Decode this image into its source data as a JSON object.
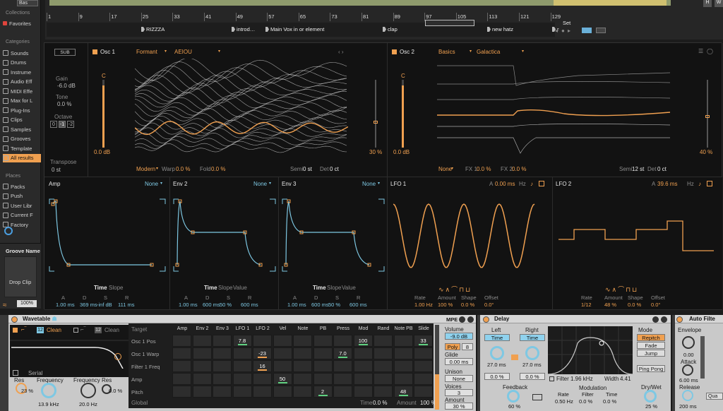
{
  "browser": {
    "top_label": "Bas",
    "collections_header": "Collections",
    "favorites": "Favorites",
    "categories_header": "Categories",
    "categories": [
      "Sounds",
      "Drums",
      "Instrume",
      "Audio Eff",
      "MIDI Effe",
      "Max for L",
      "Plug-Ins",
      "Clips",
      "Samples",
      "Grooves",
      "Template",
      "All results"
    ],
    "places_header": "Places",
    "places": [
      "Packs",
      "Push",
      "User Libr",
      "Current F",
      "Factory"
    ],
    "groove_name": "Groove Name",
    "drop_clip": "Drop Clip",
    "zoom": "100%"
  },
  "arrangement": {
    "markers": [
      "1",
      "9",
      "17",
      "25",
      "33",
      "41",
      "49",
      "57",
      "65",
      "73",
      "81",
      "89",
      "97",
      "105",
      "113",
      "121",
      "129"
    ],
    "locators": [
      "RIZZZA",
      "introd…",
      "Main Vox in or element",
      "clap",
      "new hatz",
      "r"
    ],
    "set_label": "Set",
    "top_buttons": [
      "H",
      "W"
    ]
  },
  "sub": {
    "label": "SUB",
    "gain_label": "Gain",
    "gain_value": "-6.0 dB",
    "tone_label": "Tone",
    "tone_value": "0.0 %",
    "octave_label": "Octave",
    "octave_options": [
      "0",
      "-1",
      "-2"
    ],
    "transpose_label": "Transpose",
    "transpose_value": "0 st"
  },
  "osc1": {
    "label": "Osc 1",
    "category": "Formant",
    "table": "AEIOU",
    "note": "C",
    "gain": "0.0 dB",
    "level": "30 %",
    "mode": "Modern",
    "warp_label": "Warp",
    "warp": "0.0 %",
    "fold_label": "Fold",
    "fold": "0.0 %",
    "semi_label": "Semi",
    "semi": "0 st",
    "det_label": "Det",
    "det": "0 ct"
  },
  "osc2": {
    "label": "Osc 2",
    "category": "Basics",
    "table": "Galactica",
    "note": "C",
    "gain": "0.0 dB",
    "level": "40 %",
    "fx_mode": "None",
    "fx1_label": "FX 1",
    "fx1": "0.0 %",
    "fx2_label": "FX 2",
    "fx2": "0.0 %",
    "semi_label": "Semi",
    "semi": "12 st",
    "det_label": "Det",
    "det": "0 ct"
  },
  "envs": [
    {
      "name": "Amp",
      "target": "None",
      "footer": [
        "Time",
        "Slope"
      ],
      "params": [
        [
          "A",
          "1.00 ms"
        ],
        [
          "D",
          "369 ms"
        ],
        [
          "S",
          "-inf dB"
        ],
        [
          "R",
          "111 ms"
        ]
      ]
    },
    {
      "name": "Env 2",
      "target": "None",
      "footer": [
        "Time",
        "Slope",
        "Value"
      ],
      "params": [
        [
          "A",
          "1.00 ms"
        ],
        [
          "D",
          "600 ms"
        ],
        [
          "S",
          "50 %"
        ],
        [
          "R",
          "600 ms"
        ]
      ]
    },
    {
      "name": "Env 3",
      "target": "None",
      "footer": [
        "Time",
        "Slope",
        "Value"
      ],
      "params": [
        [
          "A",
          "1.00 ms"
        ],
        [
          "D",
          "600 ms"
        ],
        [
          "S",
          "50 %"
        ],
        [
          "R",
          "600 ms"
        ]
      ]
    }
  ],
  "lfo1": {
    "name": "LFO 1",
    "a_label": "A",
    "a_value": "0.00 ms",
    "unit": "Hz",
    "params": [
      [
        "Rate",
        "1.00 Hz"
      ],
      [
        "Amount",
        "100 %"
      ],
      [
        "Shape",
        "0.0 %"
      ],
      [
        "Offset",
        "0.0°"
      ]
    ]
  },
  "lfo2": {
    "name": "LFO 2",
    "a_label": "A",
    "a_value": "39.6 ms",
    "unit": "Hz",
    "params": [
      [
        "Rate",
        "1/12"
      ],
      [
        "Amount",
        "48 %"
      ],
      [
        "Shape",
        "0.0 %"
      ],
      [
        "Offset",
        "0.0°"
      ]
    ]
  },
  "wavetable_device": {
    "title": "Wavetable",
    "filter1_num": "12",
    "filter1_type": "Clean",
    "filter2_num": "12",
    "filter2_type": "Clean",
    "routing": "Serial",
    "res_label": "Res",
    "res_value": "23 %",
    "freq_label": "Frequency",
    "freq_value": "13.9 kHz",
    "freq2_label": "Frequency",
    "freq2_value": "20.0 Hz",
    "res2_label": "Res",
    "res2_value": "0.0 %",
    "mpe_label": "MPE"
  },
  "matrix": {
    "target_header": "Target",
    "columns": [
      "Amp",
      "Env 2",
      "Env 3",
      "LFO 1",
      "LFO 2",
      "Vel",
      "Note",
      "PB",
      "Press",
      "Mod",
      "Rand",
      "Note PB",
      "Slide"
    ],
    "rows": [
      {
        "name": "Osc 1 Pos",
        "cells": {
          "3": "7.8",
          "9": "100",
          "12": "33"
        }
      },
      {
        "name": "Osc 1 Warp",
        "cells": {
          "4": "-23",
          "8": "7.0"
        }
      },
      {
        "name": "Filter 1 Freq",
        "cells": {
          "4": "16"
        }
      },
      {
        "name": "Amp",
        "cells": {
          "5": "50"
        }
      },
      {
        "name": "Pitch",
        "cells": {
          "7": "2",
          "11": "48"
        }
      }
    ],
    "global_label": "Global",
    "time_label": "Time",
    "time_value": "0.0 %",
    "amount_label": "Amount",
    "amount_value": "100 %"
  },
  "voice": {
    "volume_label": "Volume",
    "volume_value": "-9.0 dB",
    "poly_label": "Poly",
    "poly_voices": "8",
    "glide_label": "Glide",
    "glide_value": "0.00 ms",
    "unison_label": "Unison",
    "unison_value": "None",
    "voices_label": "Voices",
    "voices_value": "3",
    "amount_label": "Amount",
    "amount_value": "30 %"
  },
  "delay": {
    "title": "Delay",
    "left_label": "Left",
    "right_label": "Right",
    "time_btn": "Time",
    "left_ms": "27.0 ms",
    "right_ms": "27.0 ms",
    "left_pct": "0.0 %",
    "right_pct": "0.0 %",
    "feedback_label": "Feedback",
    "feedback_value": "60 %",
    "filter_label": "Filter",
    "filter_value": "1.96 kHz",
    "width_label": "Width",
    "width_value": "4.41",
    "modulation_label": "Modulation",
    "mod_params": [
      [
        "Rate",
        "0.50 Hz"
      ],
      [
        "Filter",
        "0.0 %"
      ],
      [
        "Time",
        "0.0 %"
      ]
    ],
    "mode_label": "Mode",
    "modes": [
      "Repitch",
      "Fade",
      "Jump"
    ],
    "pingpong": "Ping Pong",
    "drywet_label": "Dry/Wet",
    "drywet_value": "25 %"
  },
  "autofilter": {
    "title": "Auto Filte",
    "envelope_label": "Envelope",
    "envelope_value": "0.00",
    "attack_label": "Attack",
    "attack_value": "6.00 ms",
    "release_label": "Release",
    "release_value": "200 ms",
    "qual_label": "Qua"
  },
  "colors": {
    "accent_orange": "#f0a050",
    "accent_blue": "#7ec8e3",
    "bg_dark": "#121212",
    "device_grey": "#c9c9c9"
  }
}
